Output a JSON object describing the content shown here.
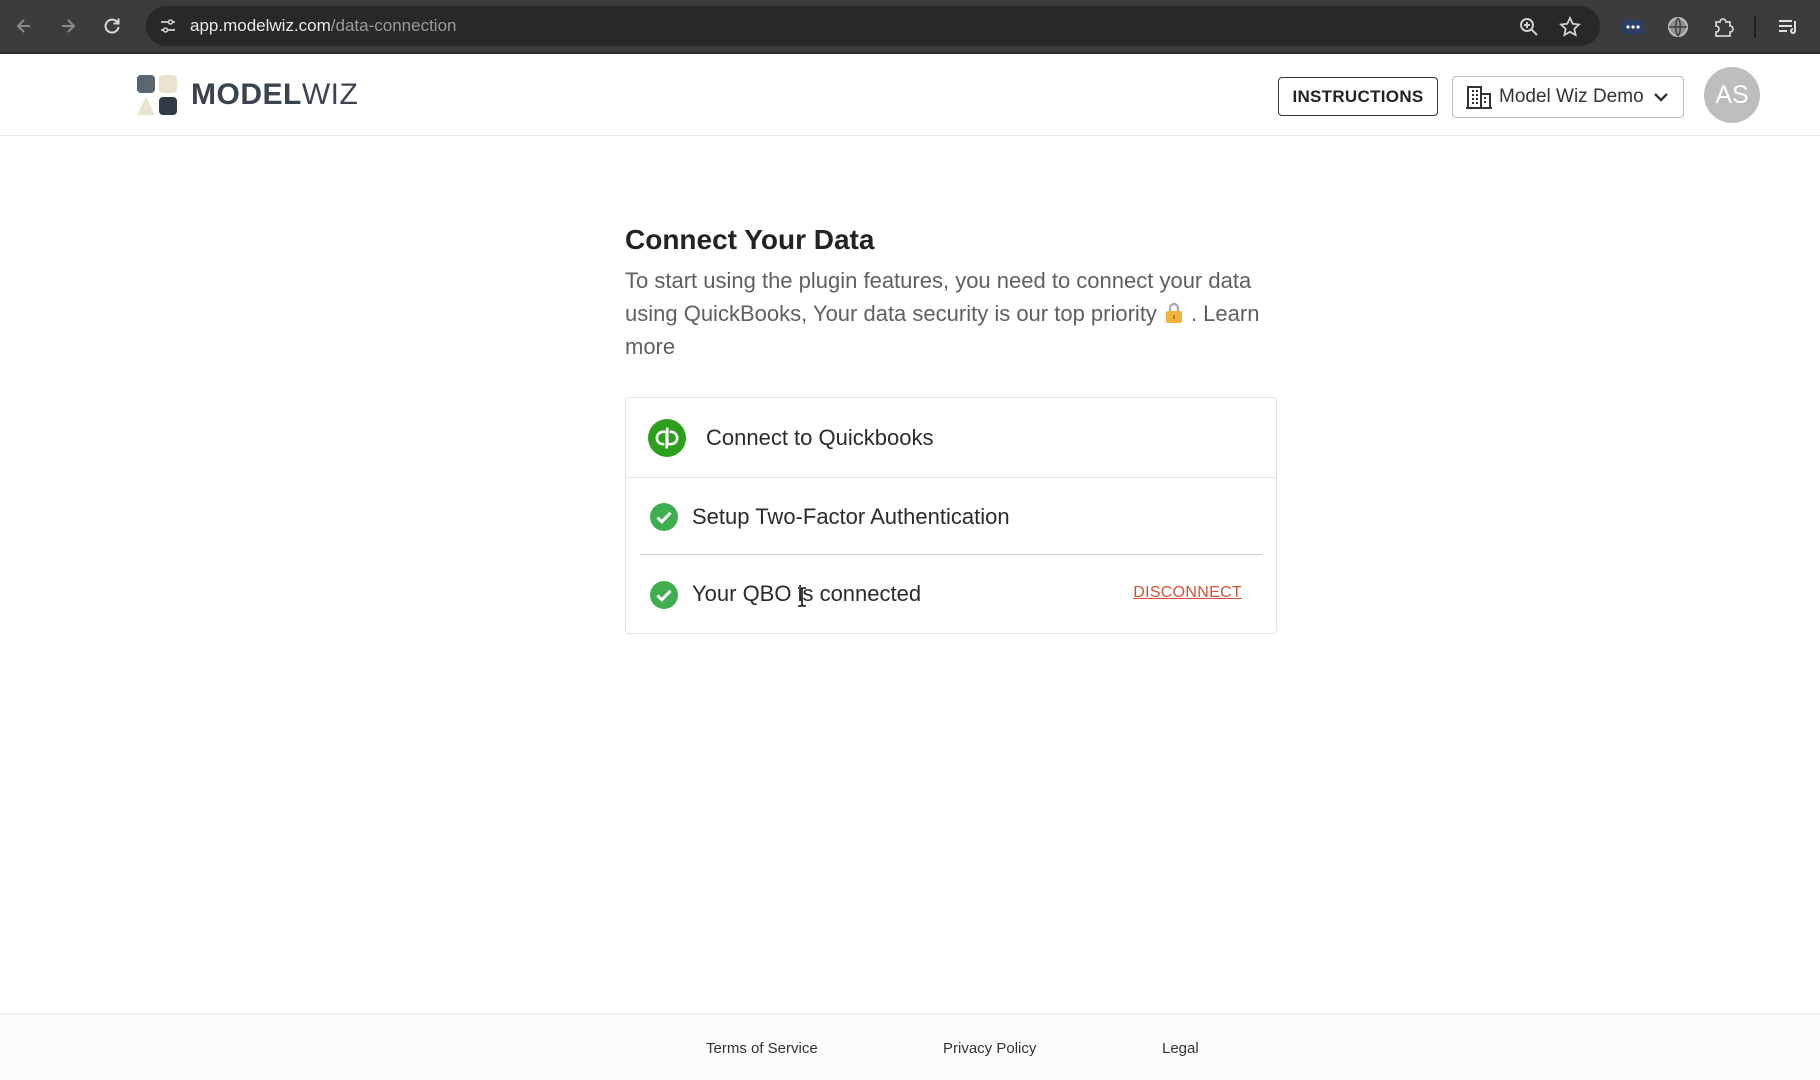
{
  "browser": {
    "url_host": "app.modelwiz.com",
    "url_path": "/data-connection"
  },
  "header": {
    "brand_bold": "MODEL",
    "brand_light": "WIZ",
    "instructions_label": "INSTRUCTIONS",
    "company_name": "Model Wiz Demo",
    "avatar_initials": "AS"
  },
  "main": {
    "title": "Connect Your Data",
    "description_part1": "To start using the plugin features, you need to connect your data using QuickBooks, Your data security is our top priority",
    "description_part2": ". Learn more",
    "steps": [
      {
        "label": "Connect to Quickbooks"
      },
      {
        "label": "Setup Two-Factor Authentication"
      },
      {
        "label": "Your QBO is connected",
        "action": "DISCONNECT"
      }
    ]
  },
  "footer": {
    "links": [
      "Terms of Service",
      "Privacy Policy",
      "Legal"
    ]
  },
  "colors": {
    "accent_green": "#2ca01c",
    "check_green": "#3fae4f",
    "disconnect_red": "#d0523a"
  }
}
